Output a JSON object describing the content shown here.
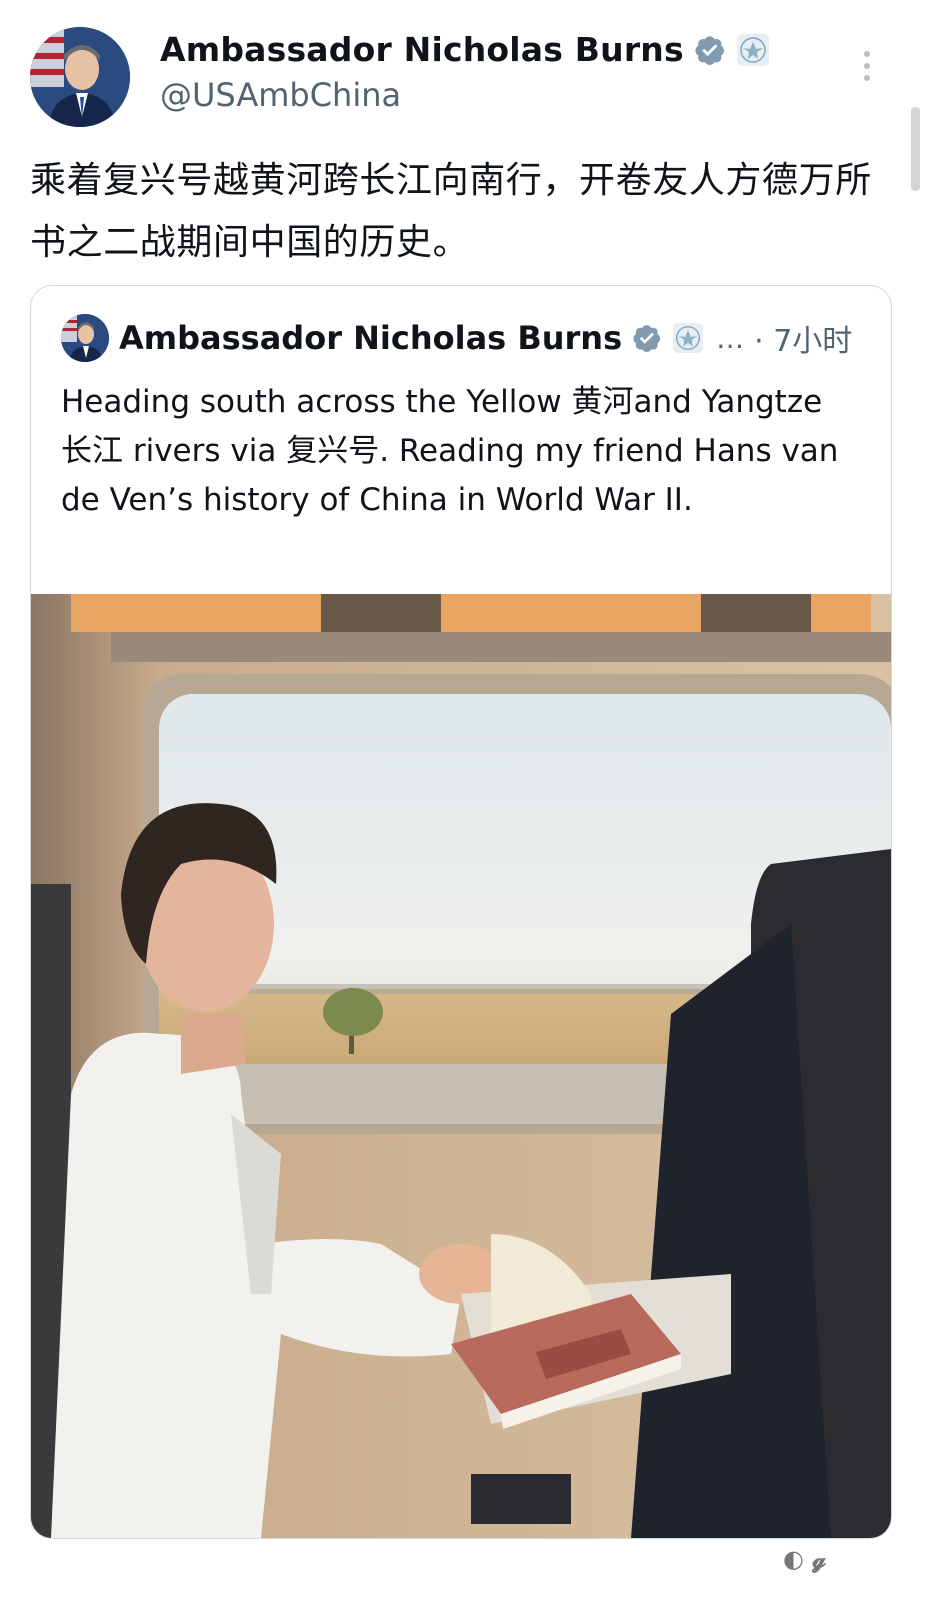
{
  "tweet": {
    "author_name": "Ambassador Nicholas Burns",
    "handle": "@USAmbChina",
    "text": "乘着复兴号越黄河跨长江向南行，开卷友人方德万所书之二战期间中国的历史。"
  },
  "quoted": {
    "author_name": "Ambassador Nicholas Burns",
    "ellipsis": "…",
    "time": "· 7小时",
    "text": "Heading south across the Yellow 黄河and Yangtze 长江 rivers via  复兴号. Reading my friend Hans van de Ven’s history of China in World War II.",
    "photo_alt": "Man in white shirt looking out of a high-speed train window with a book on the table"
  },
  "colors": {
    "verified": "#536471",
    "text": "#0f1419",
    "secondary": "#536471",
    "border": "#cfd9de"
  },
  "icons": [
    "verified-badge-icon",
    "us-seal-icon",
    "more-options-icon"
  ]
}
